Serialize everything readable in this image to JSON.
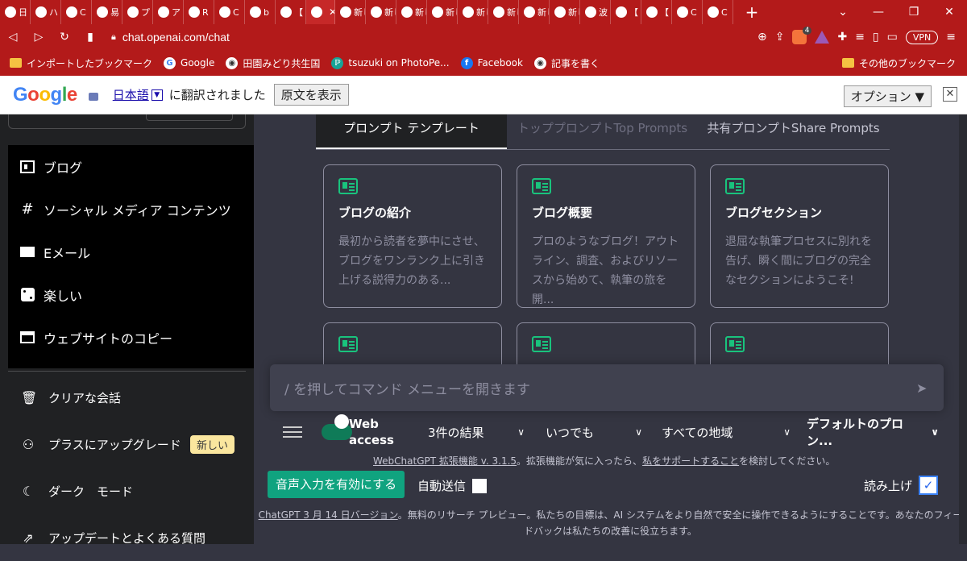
{
  "browser": {
    "tabs": [
      "日",
      "ハ",
      "C",
      "易",
      "プ",
      "ア",
      "R",
      "C",
      "b",
      "【",
      "",
      "新しい",
      "新しい",
      "新しい",
      "新しい",
      "新しい",
      "新しい",
      "新しい",
      "新しい",
      "波",
      "【",
      "【",
      "C",
      "C"
    ],
    "url": "chat.openai.com/chat",
    "vpn_label": "VPN",
    "brave_count": "4",
    "window_controls": [
      "⌄",
      "—",
      "❐",
      "✕"
    ]
  },
  "bookmarks": {
    "items": [
      {
        "label": "インポートしたブックマーク",
        "icon": "folder-icon"
      },
      {
        "label": "Google",
        "icon": "google-icon"
      },
      {
        "label": "田園みどり共生国",
        "icon": "globe-icon"
      },
      {
        "label": "tsuzuki on PhotoPe...",
        "icon": "photopea-icon"
      },
      {
        "label": "Facebook",
        "icon": "facebook-icon"
      },
      {
        "label": "記事を書く",
        "icon": "globe-icon"
      }
    ],
    "other": "その他のブックマーク"
  },
  "translate_bar": {
    "logo": [
      "G",
      "o",
      "o",
      "g",
      "l",
      "e"
    ],
    "language": "日本語",
    "message": "に翻訳されました",
    "show_original": "原文を表示",
    "options": "オプション ▼",
    "close": "✕"
  },
  "sidebar": {
    "menu": [
      {
        "label": "ブログ",
        "icon": "newspaper-icon"
      },
      {
        "label": "ソーシャル メディア コンテンツ",
        "icon": "hash-icon"
      },
      {
        "label": "Eメール",
        "icon": "mail-icon"
      },
      {
        "label": "楽しい",
        "icon": "dice-icon"
      },
      {
        "label": "ウェブサイトのコピー",
        "icon": "window-icon"
      }
    ],
    "lower": [
      {
        "label": "クリアな会話",
        "icon": "trash-icon"
      },
      {
        "label": "プラスにアップグレード",
        "icon": "user-icon",
        "badge": "新しい"
      },
      {
        "label": "ダーク　モード",
        "icon": "moon-icon"
      },
      {
        "label": "アップデートとよくある質問",
        "icon": "external-link-icon"
      }
    ]
  },
  "main": {
    "tabs": [
      {
        "label": "プロンプト テンプレート",
        "active": true
      },
      {
        "label": "トッププロンプトTop Prompts",
        "active": false
      },
      {
        "label": "共有プロンプトShare Prompts",
        "active": false
      }
    ],
    "cards": [
      {
        "title": "ブログの紹介",
        "desc": "最初から読者を夢中にさせ、ブログをワンランク上に引き上げる説得力のある..."
      },
      {
        "title": "ブログ概要",
        "desc": "プロのようなブログ！アウトライン、調査、およびリソースから始めて、執筆の旅を開..."
      },
      {
        "title": "ブログセクション",
        "desc": "退屈な執筆プロセスに別れを告げ、瞬く間にブログの完全なセクションにようこそ!"
      }
    ],
    "input_placeholder": "/ を押してコマンド メニューを開きます",
    "web_access": "Web access",
    "selects": [
      "3件の結果",
      "いつでも",
      "すべての地域",
      "デフォルトのプロン..."
    ],
    "webchatgpt_note": {
      "link1": "WebChatGPT 拡張機能 v. 3.1.5",
      "text": "。拡張機能が気に入ったら、",
      "link2": "私をサポートすること",
      "tail": "を検討してください。"
    },
    "voice_button": "音声入力を有効にする",
    "auto_send": "自動送信",
    "read_aloud": "読み上げ",
    "read_aloud_check": "✓",
    "footer_link": "ChatGPT 3 月 14 日バージョン",
    "footer_text": "。無料のリサーチ プレビュー。私たちの目標は、AI システムをより自然で安全に操作できるようにすることです。あなたのフィードバックは私たちの改善に役立ちます。"
  },
  "colors": {
    "browser_chrome": "#b31a1a",
    "sidebar": "#202123",
    "main": "#343541",
    "accent_green": "#10a37f",
    "badge": "#fae69e"
  }
}
